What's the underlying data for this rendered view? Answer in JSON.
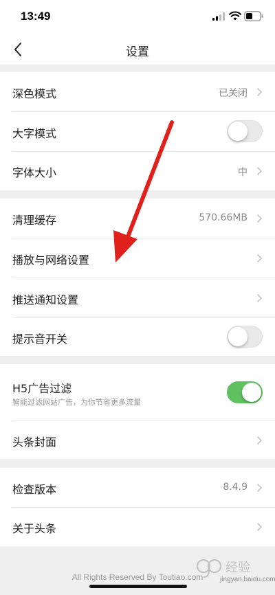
{
  "status_bar": {
    "time": "13:49"
  },
  "nav": {
    "title": "设置",
    "back_icon": "chevron-left-icon"
  },
  "group1": {
    "dark_mode": {
      "label": "深色模式",
      "value": "已关闭"
    },
    "large_text": {
      "label": "大字模式",
      "enabled": false
    },
    "font_size": {
      "label": "字体大小",
      "value": "中"
    }
  },
  "group2": {
    "clear_cache": {
      "label": "清理缓存",
      "value": "570.66MB"
    },
    "playback_network": {
      "label": "播放与网络设置"
    },
    "push_notifications": {
      "label": "推送通知设置"
    },
    "sound_toggle": {
      "label": "提示音开关",
      "enabled": false
    }
  },
  "group3": {
    "h5_ad_filter": {
      "label": "H5广告过滤",
      "sub": "智能过滤网站广告，为你节省更多流量",
      "enabled": true
    },
    "headline_cover": {
      "label": "头条封面"
    }
  },
  "group4": {
    "check_version": {
      "label": "检查版本",
      "value": "8.4.9"
    },
    "about": {
      "label": "关于头条"
    }
  },
  "footer": {
    "text": "All Rights Reserved By Toutiao.com"
  },
  "watermark": {
    "text": "jingyan.baidu.com"
  },
  "colors": {
    "toggle_on": "#5fc160",
    "arrow": "#e0211b",
    "background": "#efefef"
  }
}
